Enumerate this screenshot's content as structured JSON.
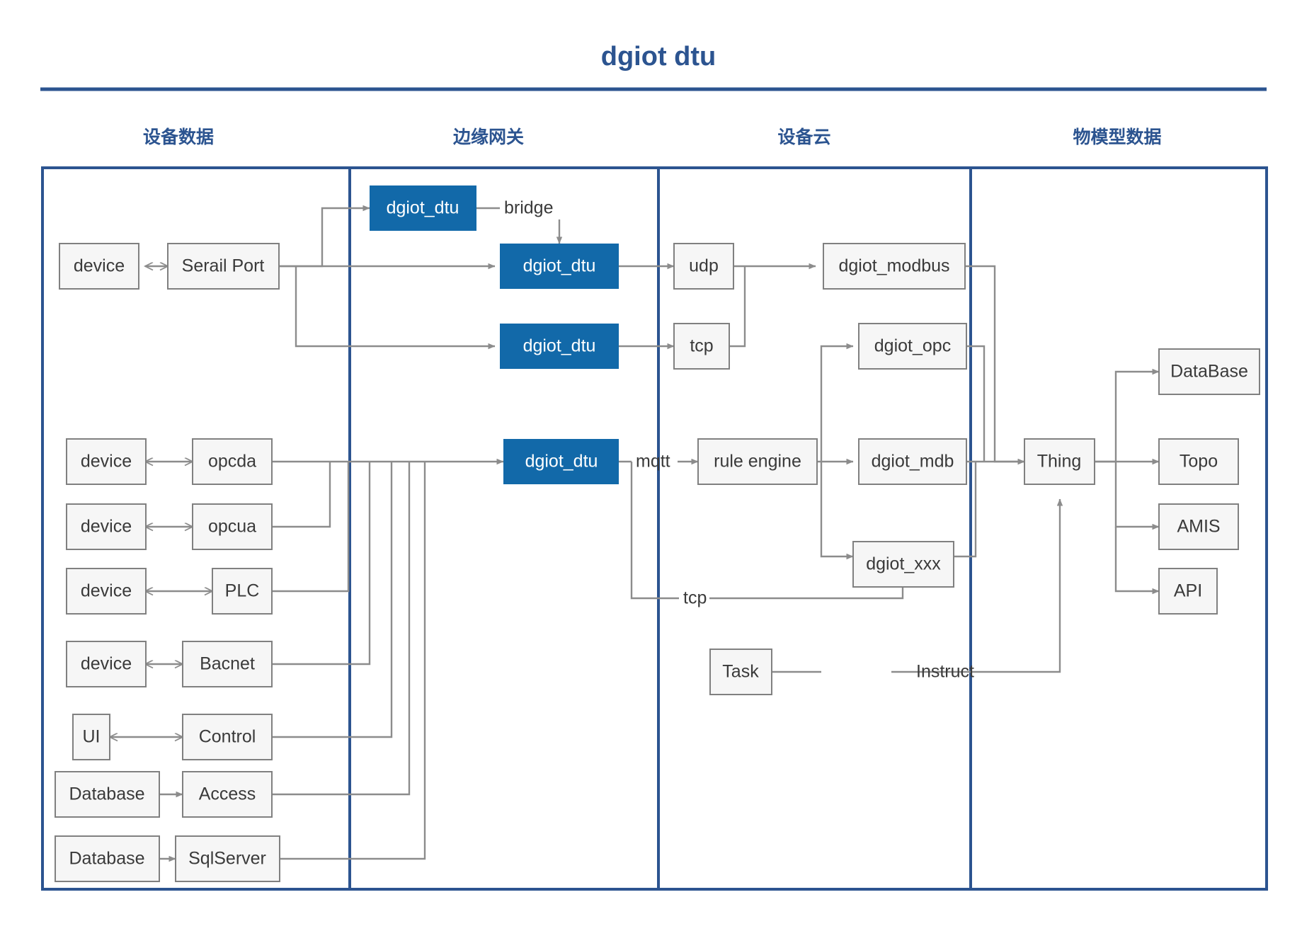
{
  "title": "dgiot dtu",
  "colors": {
    "brand_blue": "#2c5490",
    "accent_blue": "#1269a9",
    "node_fill": "#f6f6f6",
    "node_stroke": "#808080",
    "link_stroke": "#8c8c8c",
    "text": "#3a3a3a"
  },
  "columns": [
    {
      "id": "device-data",
      "header": "设备数据"
    },
    {
      "id": "edge-gateway",
      "header": "边缘网关"
    },
    {
      "id": "device-cloud",
      "header": "设备云"
    },
    {
      "id": "thing-model-data",
      "header": "物模型数据"
    }
  ],
  "nodes": {
    "device1": {
      "label": "device"
    },
    "serial_port": {
      "label": "Serail Port"
    },
    "device2": {
      "label": "device"
    },
    "opcda": {
      "label": "opcda"
    },
    "device3": {
      "label": "device"
    },
    "opcua": {
      "label": "opcua"
    },
    "device4": {
      "label": "device"
    },
    "plc": {
      "label": "PLC"
    },
    "device5": {
      "label": "device"
    },
    "bacnet": {
      "label": "Bacnet"
    },
    "ui": {
      "label": "UI"
    },
    "control": {
      "label": "Control"
    },
    "database1": {
      "label": "Database"
    },
    "access": {
      "label": "Access"
    },
    "database2": {
      "label": "Database"
    },
    "sqlserver": {
      "label": "SqlServer"
    },
    "dgiot_dtu_1": {
      "label": "dgiot_dtu"
    },
    "dgiot_dtu_2": {
      "label": "dgiot_dtu"
    },
    "dgiot_dtu_3": {
      "label": "dgiot_dtu"
    },
    "dgiot_dtu_4": {
      "label": "dgiot_dtu"
    },
    "udp": {
      "label": "udp"
    },
    "tcp_node": {
      "label": "tcp"
    },
    "rule_engine": {
      "label": "rule engine"
    },
    "dgiot_modbus": {
      "label": "dgiot_modbus"
    },
    "dgiot_opc": {
      "label": "dgiot_opc"
    },
    "dgiot_mdb": {
      "label": "dgiot_mdb"
    },
    "dgiot_xxx": {
      "label": "dgiot_xxx"
    },
    "task": {
      "label": "Task"
    },
    "thing": {
      "label": "Thing"
    },
    "db_out": {
      "label": "DataBase"
    },
    "topo": {
      "label": "Topo"
    },
    "amis": {
      "label": "AMIS"
    },
    "api": {
      "label": "API"
    }
  },
  "edge_labels": {
    "bridge": "bridge",
    "mqtt": "mqtt",
    "tcp": "tcp",
    "instruct": "Instruct"
  }
}
